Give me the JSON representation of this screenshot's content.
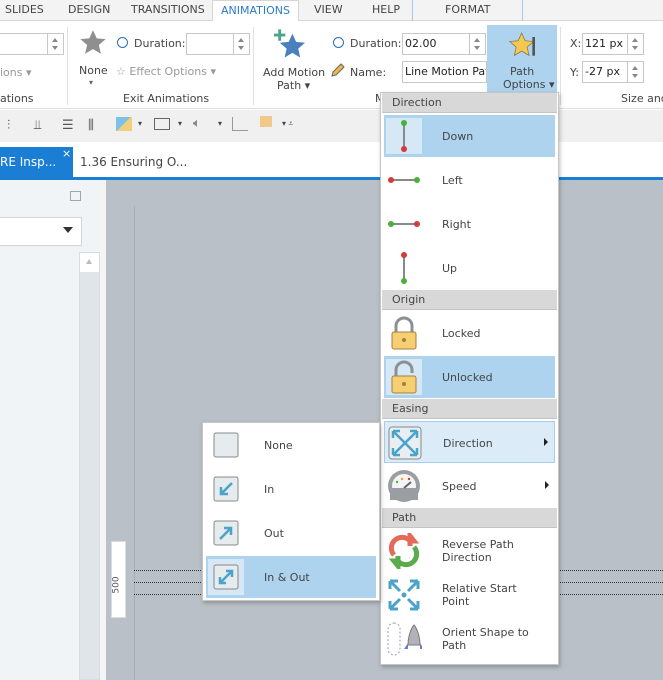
{
  "tabs": [
    "SLIDES",
    "DESIGN",
    "TRANSITIONS",
    "ANIMATIONS",
    "VIEW",
    "HELP",
    "FORMAT"
  ],
  "ribbon": {
    "left_partial": {
      "options": "ions",
      "group": "ations"
    },
    "exit": {
      "none": "None",
      "duration_label": "Duration:",
      "duration_value": "",
      "effect_options": "Effect Options",
      "group": "Exit Animations"
    },
    "motion": {
      "add_line1": "Add Motion",
      "add_line2": "Path",
      "duration_label": "Duration:",
      "duration_value": "02.00",
      "name_label": "Name:",
      "name_value": "Line Motion Pat",
      "path_line1": "Path",
      "path_line2": "Options",
      "group": "M"
    },
    "size": {
      "x_label": "X:",
      "x_value": "121 px",
      "y_label": "Y:",
      "y_value": "-27 px",
      "group": "Size and"
    }
  },
  "doc_tabs": [
    {
      "label": "RE Insp...",
      "close": "×"
    },
    {
      "label": "1.36 Ensuring O..."
    }
  ],
  "ruler": {
    "label": "500"
  },
  "menu": {
    "sections": [
      {
        "header": "Direction",
        "items": [
          {
            "label": "Down",
            "icon": "path-down-icon",
            "state": "sel"
          },
          {
            "label": "Left",
            "icon": "path-left-icon"
          },
          {
            "label": "Right",
            "icon": "path-right-icon"
          },
          {
            "label": "Up",
            "icon": "path-up-icon"
          }
        ]
      },
      {
        "header": "Origin",
        "items": [
          {
            "label": "Locked",
            "icon": "lock-icon"
          },
          {
            "label": "Unlocked",
            "icon": "unlock-icon",
            "state": "sel"
          }
        ]
      },
      {
        "header": "Easing",
        "items": [
          {
            "label": "Direction",
            "icon": "easing-direction-icon",
            "state": "hov",
            "submenu": true
          },
          {
            "label": "Speed",
            "icon": "speedometer-icon",
            "submenu": true
          }
        ]
      },
      {
        "header": "Path",
        "items": [
          {
            "label": "Reverse Path Direction",
            "icon": "reverse-path-icon"
          },
          {
            "label": "Relative Start Point",
            "icon": "relative-start-icon"
          },
          {
            "label": "Orient Shape to Path",
            "icon": "orient-shape-icon"
          }
        ]
      }
    ]
  },
  "submenu": {
    "items": [
      {
        "label": "None",
        "icon": "ease-none-icon"
      },
      {
        "label": "In",
        "icon": "ease-in-icon"
      },
      {
        "label": "Out",
        "icon": "ease-out-icon"
      },
      {
        "label": "In & Out",
        "icon": "ease-in-out-icon",
        "state": "sel"
      }
    ]
  },
  "colors": {
    "accent": "#1a7fd4",
    "highlight": "#aed3ef",
    "canvas": "#b9c0c7"
  }
}
